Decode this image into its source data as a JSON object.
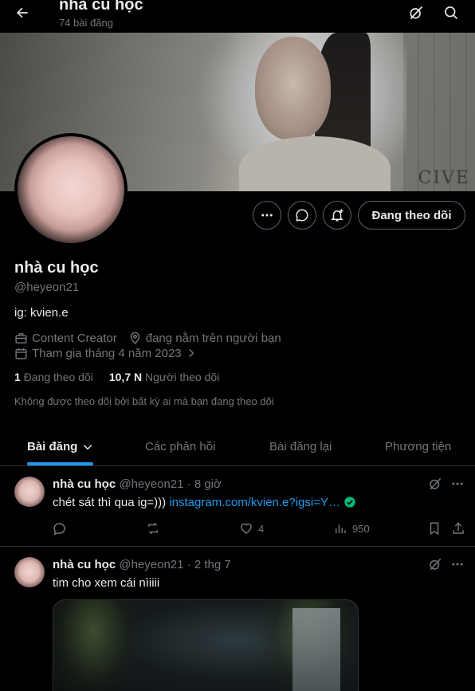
{
  "header": {
    "title": "nhà cu học",
    "post_count": "74 bài đăng"
  },
  "banner": {
    "wall_text": "CIVE"
  },
  "profile": {
    "name": "nhà cu học",
    "handle": "@heyeon21",
    "bio": "ig: kvien.e",
    "category": "Content Creator",
    "location": "đang nằm trên người bạn",
    "joined": "Tham gia tháng 4 năm 2023",
    "following_count": "1",
    "following_label": "Đang theo dõi",
    "followers_count": "10,7 N",
    "followers_label": "Người theo dõi",
    "not_followed_note": "Không được theo dõi bởi bất kỳ ai mà bạn đang theo dõi",
    "follow_button": "Đang theo dõi"
  },
  "tabs": [
    {
      "label": "Bài đăng"
    },
    {
      "label": "Các phản hồi"
    },
    {
      "label": "Bài đăng lại"
    },
    {
      "label": "Phương tiện"
    }
  ],
  "posts": [
    {
      "author": "nhà cu học",
      "handle": "@heyeon21",
      "time": "· 8 giờ",
      "text": "chét sát thì qua ig=)))",
      "link": "instagram.com/kvien.e?igsi=Y…",
      "likes": "4",
      "views": "950"
    },
    {
      "author": "nhà cu học",
      "handle": "@heyeon21",
      "time": "· 2 thg 7",
      "text": "tim cho xem cái nìiiii"
    }
  ],
  "colors": {
    "accent": "#1d9bf0",
    "muted": "#71767b",
    "border": "#2f3336",
    "verified": "#00ba7c"
  }
}
